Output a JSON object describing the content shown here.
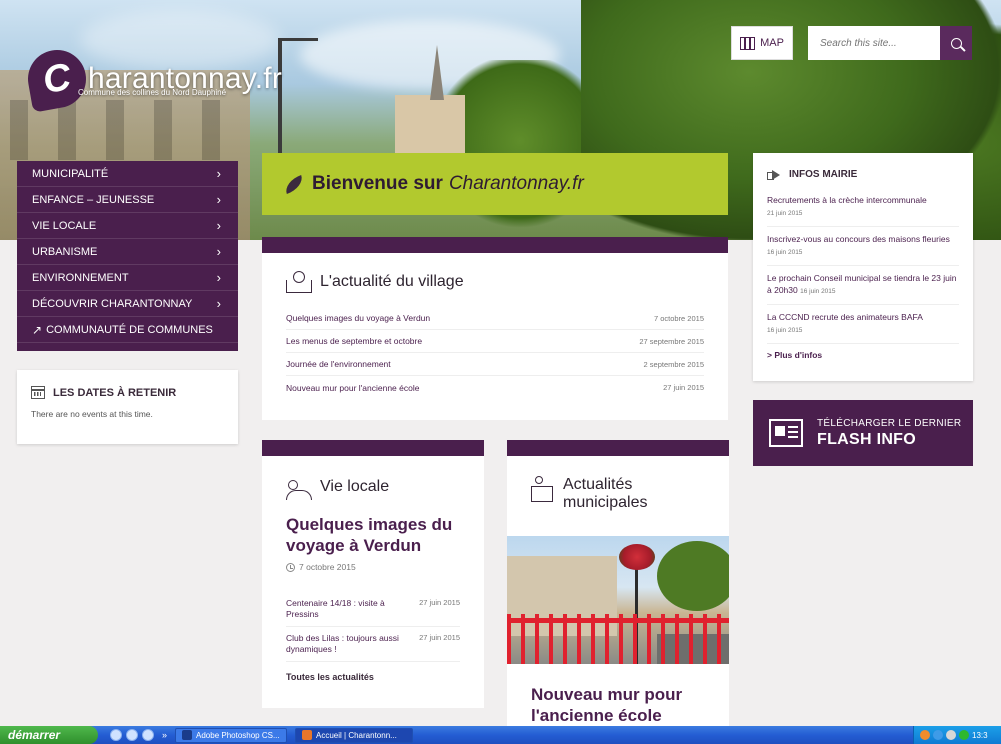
{
  "site": {
    "logo_text": "harantonnay.fr",
    "logo_letter": "C",
    "tagline": "Commune des collines du Nord Dauphiné",
    "map_label": "MAP",
    "search_placeholder": "Search this site..."
  },
  "nav": {
    "items": [
      {
        "label": "MUNICIPALITÉ",
        "chevron": "›"
      },
      {
        "label": "ENFANCE – JEUNESSE",
        "chevron": "›"
      },
      {
        "label": "VIE LOCALE",
        "chevron": "›"
      },
      {
        "label": "URBANISME",
        "chevron": "›"
      },
      {
        "label": "ENVIRONNEMENT",
        "chevron": "›"
      },
      {
        "label": "DÉCOUVRIR CHARANTONNAY",
        "chevron": "›"
      }
    ],
    "external": {
      "icon": "↗",
      "label": "COMMUNAUTÉ DE COMMUNES"
    }
  },
  "dates": {
    "title": "LES DATES À RETENIR",
    "empty": "There are no events at this time."
  },
  "welcome": {
    "bold": "Bienvenue sur",
    "italic": "Charantonnay.fr"
  },
  "actualite": {
    "title": "L'actualité du village",
    "items": [
      {
        "title": "Quelques images du voyage à Verdun",
        "date": "7 octobre 2015"
      },
      {
        "title": "Les menus de septembre et octobre",
        "date": "27 septembre 2015"
      },
      {
        "title": "Journée de l'environnement",
        "date": "2 septembre 2015"
      },
      {
        "title": "Nouveau mur pour l'ancienne école",
        "date": "27 juin 2015"
      }
    ]
  },
  "vie_locale": {
    "title": "Vie locale",
    "feature_title": "Quelques images du voyage à Verdun",
    "feature_date": "7 octobre 2015",
    "items": [
      {
        "title": "Centenaire 14/18 : visite à Pressins",
        "date": "27 juin 2015"
      },
      {
        "title": "Club des Lilas : toujours aussi dynamiques !",
        "date": "27 juin 2015"
      }
    ],
    "all_link": "Toutes les actualités"
  },
  "municipales": {
    "title": "Actualités municipales",
    "feature_title": "Nouveau mur pour l'ancienne école"
  },
  "infos": {
    "title": "INFOS MAIRIE",
    "items": [
      {
        "title": "Recrutements à la crèche intercommunale",
        "date": "21 juin 2015"
      },
      {
        "title": "Inscrivez-vous au concours des maisons fleuries",
        "date": "16 juin 2015"
      },
      {
        "title": "Le prochain Conseil municipal se tiendra le 23 juin à 20h30",
        "date": "16 juin 2015"
      },
      {
        "title": "La CCCND recrute des animateurs BAFA",
        "date": "16 juin 2015"
      }
    ],
    "more_link": "> Plus d'infos"
  },
  "flash": {
    "line1": "TÉLÉCHARGER LE DERNIER",
    "line2": "FLASH INFO"
  },
  "taskbar": {
    "start": "démarrer",
    "more": "»",
    "tasks": [
      {
        "label": "Adobe Photoshop CS...",
        "icon_color": "#1a3c8a"
      },
      {
        "label": "Accueil | Charantonn...",
        "icon_color": "#e8762b"
      }
    ],
    "clock": "13:3"
  },
  "colors": {
    "brand_purple": "#4a1f4d",
    "welcome_green": "#b2c92e"
  }
}
